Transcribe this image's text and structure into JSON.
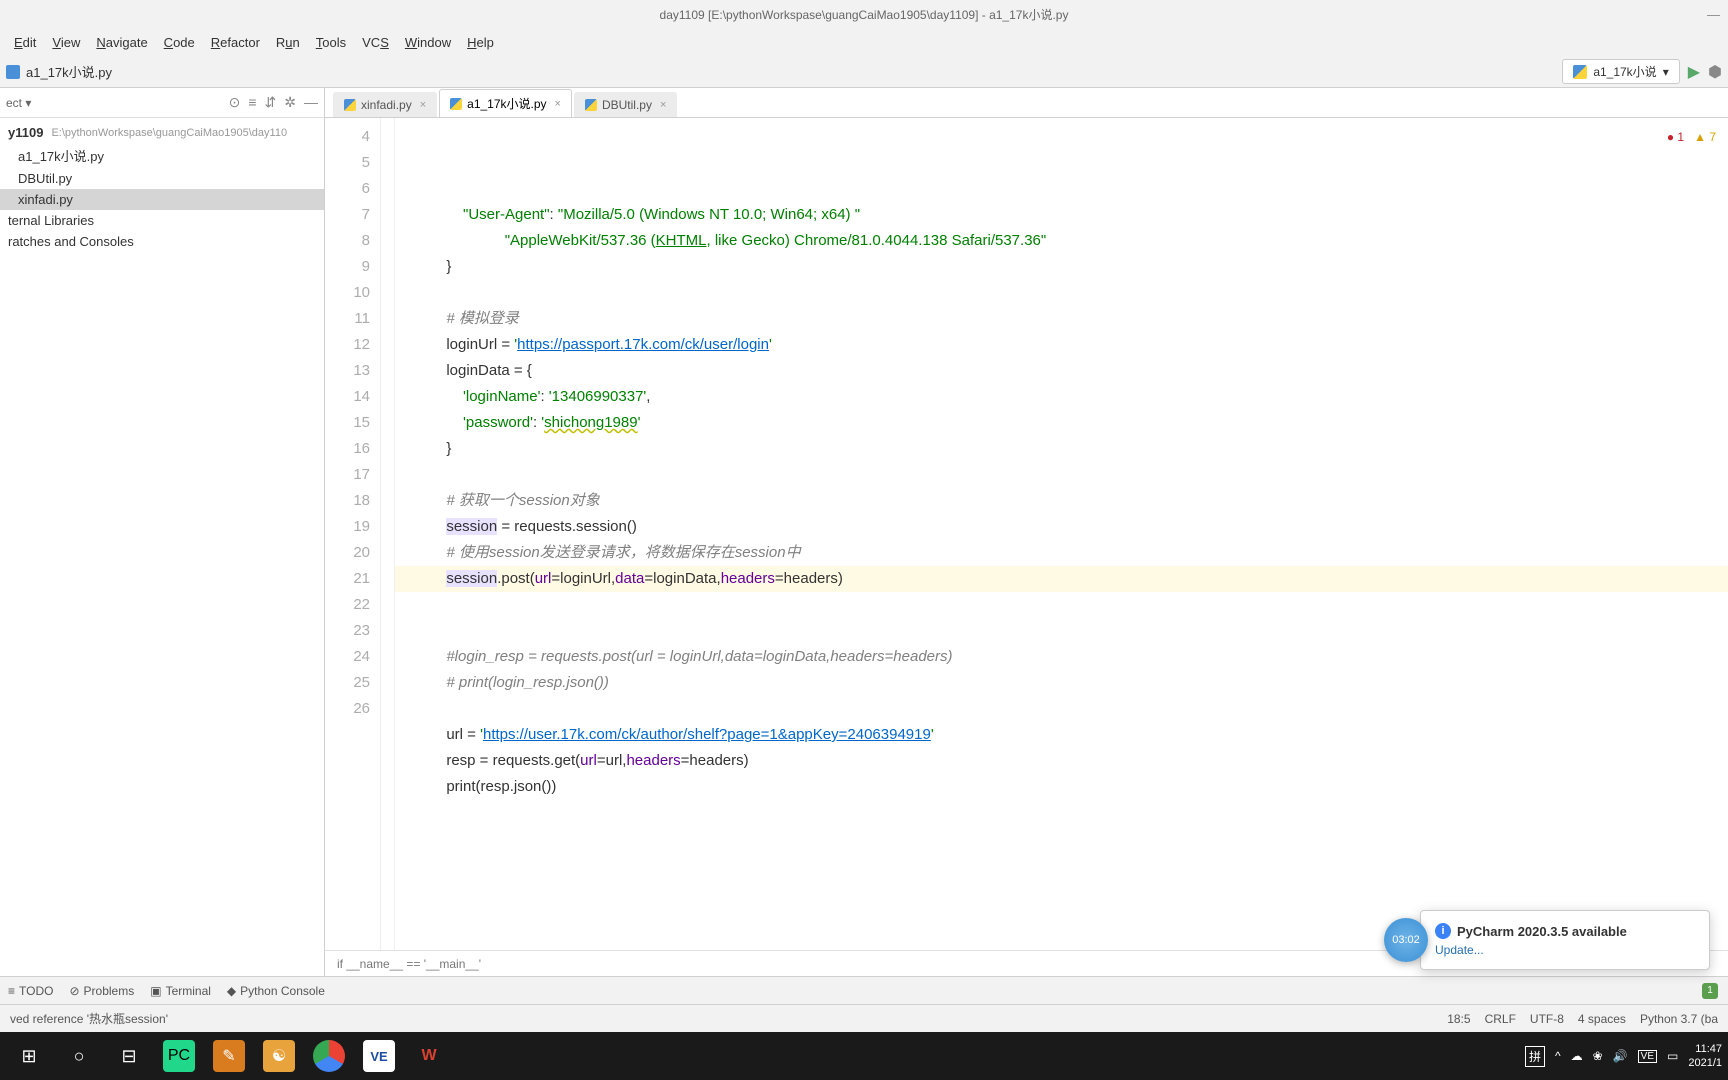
{
  "window": {
    "title": "day1109 [E:\\pythonWorkspase\\guangCaiMao1905\\day1109] - a1_17k小说.py",
    "minimize": "—"
  },
  "menu": [
    "Edit",
    "View",
    "Navigate",
    "Code",
    "Refactor",
    "Run",
    "Tools",
    "VCS",
    "Window",
    "Help"
  ],
  "toolbar": {
    "current_file": "a1_17k小说.py",
    "run_config": "a1_17k小说"
  },
  "sidebar": {
    "label": "ect",
    "root": "y1109",
    "root_path": "E:\\pythonWorkspase\\guangCaiMao1905\\day110",
    "items": [
      "a1_17k小说.py",
      "DBUtil.py",
      "xinfadi.py"
    ],
    "selected_index": 2,
    "libs": "ternal Libraries",
    "scratch": "ratches and Consoles"
  },
  "tabs": [
    {
      "label": "xinfadi.py",
      "active": false
    },
    {
      "label": "a1_17k小说.py",
      "active": true
    },
    {
      "label": "DBUtil.py",
      "active": false
    }
  ],
  "inspection": {
    "errors": "1",
    "warnings": "7"
  },
  "gutter_start": 4,
  "gutter_end": 26,
  "code_lines": [
    {
      "n": 4,
      "html": "            <span class='s-str'>\"User-Agent\"</span>: <span class='s-str'>\"Mozilla/5.0 (Windows NT 10.0; Win64; x64) \"</span>"
    },
    {
      "n": 5,
      "html": "                      <span class='s-str'>\"AppleWebKit/537.36 (<u>KHTML</u>, like Gecko) Chrome/81.0.4044.138 Safari/537.36\"</span>"
    },
    {
      "n": 6,
      "html": "        }"
    },
    {
      "n": 7,
      "html": ""
    },
    {
      "n": 8,
      "html": "        <span class='s-cmt'># 模拟登录</span>"
    },
    {
      "n": 9,
      "html": "        loginUrl = <span class='s-str'>'<span class='s-url'>https://passport.17k.com/ck/user/login</span>'</span>"
    },
    {
      "n": 10,
      "html": "        loginData = {"
    },
    {
      "n": 11,
      "html": "            <span class='s-str'>'loginName'</span>: <span class='s-str'>'13406990337'</span>,"
    },
    {
      "n": 12,
      "html": "            <span class='s-str'>'password'</span>: <span class='s-str'>'<span class='s-warn'>shichong1989</span>'</span>"
    },
    {
      "n": 13,
      "html": "        }"
    },
    {
      "n": 14,
      "html": ""
    },
    {
      "n": 15,
      "html": "        <span class='s-cmt'># 获取一个session对象</span>"
    },
    {
      "n": 16,
      "html": "        <span class='s-var-hl'>session</span> = requests.session()"
    },
    {
      "n": 17,
      "html": "        <span class='s-cmt'># 使用session发送登录请求，将数据保存在session中</span>"
    },
    {
      "n": 18,
      "html": "        <span class='s-var-hl'>session</span>.post(<span class='s-kw'>url</span>=loginUrl,<span class='s-kw'>data</span>=loginData,<span class='s-kw'>headers</span>=headers)",
      "hl": true
    },
    {
      "n": 19,
      "html": ""
    },
    {
      "n": 20,
      "html": ""
    },
    {
      "n": 21,
      "html": "        <span class='s-cmt'>#login_resp = requests.post(url = loginUrl,data=loginData,headers=headers)</span>"
    },
    {
      "n": 22,
      "html": "        <span class='s-cmt'># print(login_resp.json())</span>"
    },
    {
      "n": 23,
      "html": ""
    },
    {
      "n": 24,
      "html": "        url = <span class='s-str'>'<span class='s-url'>https://user.17k.com/ck/author/shelf?page=1&appKey=2406394919</span>'</span>"
    },
    {
      "n": 25,
      "html": "        resp = requests.get(<span class='s-kw'>url</span>=url,<span class='s-kw'>headers</span>=headers)"
    },
    {
      "n": 26,
      "html": "        print(resp.json())"
    }
  ],
  "breadcrumb": "if __name__ == '__main__'",
  "tool_windows": [
    "TODO",
    "Problems",
    "Terminal",
    "Python Console"
  ],
  "tool_badge": "1",
  "status": {
    "left": "ved reference '热水瓶session'",
    "pos": "18:5",
    "eol": "CRLF",
    "enc": "UTF-8",
    "indent": "4 spaces",
    "interp": "Python 3.7 (ba"
  },
  "notification": {
    "title": "PyCharm 2020.3.5 available",
    "link": "Update..."
  },
  "countdown": "03:02",
  "tray": {
    "ime": "拼",
    "time": "11:47",
    "date": "2021/1"
  }
}
